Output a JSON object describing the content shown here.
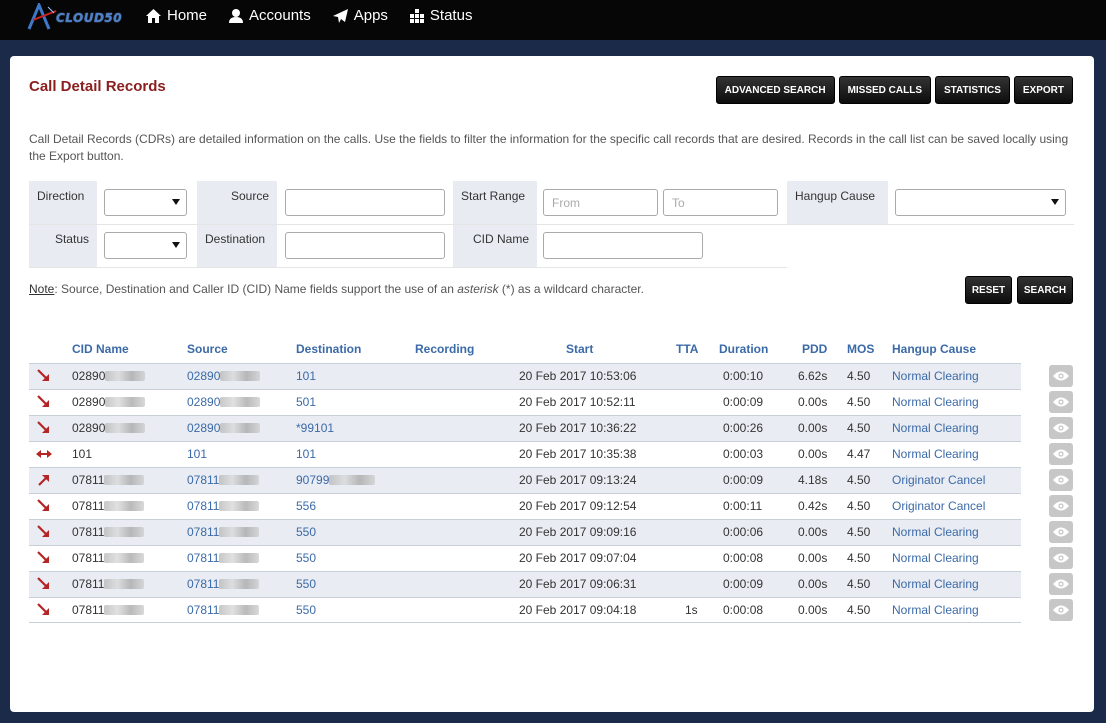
{
  "app": {
    "name": "CLOUD50"
  },
  "nav": [
    {
      "label": "Home",
      "icon": "home-icon"
    },
    {
      "label": "Accounts",
      "icon": "user-icon"
    },
    {
      "label": "Apps",
      "icon": "paper-plane-icon"
    },
    {
      "label": "Status",
      "icon": "grid-icon"
    }
  ],
  "page": {
    "title": "Call Detail Records",
    "description": "Call Detail Records (CDRs) are detailed information on the calls. Use the fields to filter the information for the specific call records that are desired. Records in the call list can be saved locally using the Export button.",
    "buttons": {
      "advanced_search": "ADVANCED SEARCH",
      "missed_calls": "MISSED CALLS",
      "statistics": "STATISTICS",
      "export": "EXPORT"
    }
  },
  "filters": {
    "direction": {
      "label": "Direction",
      "value": ""
    },
    "source": {
      "label": "Source",
      "value": ""
    },
    "start_range": {
      "label": "Start Range",
      "from_placeholder": "From",
      "to_placeholder": "To"
    },
    "hangup_cause": {
      "label": "Hangup Cause",
      "value": ""
    },
    "status": {
      "label": "Status",
      "value": ""
    },
    "destination": {
      "label": "Destination",
      "value": ""
    },
    "cid_name": {
      "label": "CID Name",
      "value": ""
    },
    "note_prefix": "Note",
    "note_text_1": ": Source, Destination and Caller ID (CID) Name fields support the use of an ",
    "note_em": "asterisk",
    "note_text_2": " (*) as a wildcard character.",
    "reset": "RESET",
    "search": "SEARCH"
  },
  "table": {
    "columns": [
      "CID Name",
      "Source",
      "Destination",
      "Recording",
      "Start",
      "TTA",
      "Duration",
      "PDD",
      "MOS",
      "Hangup Cause"
    ],
    "rows": [
      {
        "direction": "inbound",
        "cid": "02890",
        "source": "02890",
        "destination": "101",
        "recording": "",
        "start": "20 Feb 2017 10:53:06",
        "tta": "",
        "duration": "0:00:10",
        "pdd": "6.62s",
        "mos": "4.50",
        "hangup": "Normal Clearing"
      },
      {
        "direction": "inbound",
        "cid": "02890",
        "source": "02890",
        "destination": "501",
        "recording": "",
        "start": "20 Feb 2017 10:52:11",
        "tta": "",
        "duration": "0:00:09",
        "pdd": "0.00s",
        "mos": "4.50",
        "hangup": "Normal Clearing"
      },
      {
        "direction": "inbound",
        "cid": "02890",
        "source": "02890",
        "destination": "*99101",
        "recording": "",
        "start": "20 Feb 2017 10:36:22",
        "tta": "",
        "duration": "0:00:26",
        "pdd": "0.00s",
        "mos": "4.50",
        "hangup": "Normal Clearing"
      },
      {
        "direction": "internal",
        "cid": "101",
        "source": "101",
        "destination": "101",
        "recording": "",
        "start": "20 Feb 2017 10:35:38",
        "tta": "",
        "duration": "0:00:03",
        "pdd": "0.00s",
        "mos": "4.47",
        "hangup": "Normal Clearing"
      },
      {
        "direction": "outbound",
        "cid": "07811",
        "source": "07811",
        "destination": "90799",
        "recording": "",
        "start": "20 Feb 2017 09:13:24",
        "tta": "",
        "duration": "0:00:09",
        "pdd": "4.18s",
        "mos": "4.50",
        "hangup": "Originator Cancel"
      },
      {
        "direction": "inbound",
        "cid": "07811",
        "source": "07811",
        "destination": "556",
        "recording": "",
        "start": "20 Feb 2017 09:12:54",
        "tta": "",
        "duration": "0:00:11",
        "pdd": "0.42s",
        "mos": "4.50",
        "hangup": "Originator Cancel"
      },
      {
        "direction": "inbound",
        "cid": "07811",
        "source": "07811",
        "destination": "550",
        "recording": "",
        "start": "20 Feb 2017 09:09:16",
        "tta": "",
        "duration": "0:00:06",
        "pdd": "0.00s",
        "mos": "4.50",
        "hangup": "Normal Clearing"
      },
      {
        "direction": "inbound",
        "cid": "07811",
        "source": "07811",
        "destination": "550",
        "recording": "",
        "start": "20 Feb 2017 09:07:04",
        "tta": "",
        "duration": "0:00:08",
        "pdd": "0.00s",
        "mos": "4.50",
        "hangup": "Normal Clearing"
      },
      {
        "direction": "inbound",
        "cid": "07811",
        "source": "07811",
        "destination": "550",
        "recording": "",
        "start": "20 Feb 2017 09:06:31",
        "tta": "",
        "duration": "0:00:09",
        "pdd": "0.00s",
        "mos": "4.50",
        "hangup": "Normal Clearing"
      },
      {
        "direction": "inbound",
        "cid": "07811",
        "source": "07811",
        "destination": "550",
        "recording": "",
        "start": "20 Feb 2017 09:04:18",
        "tta": "1s",
        "duration": "0:00:08",
        "pdd": "0.00s",
        "mos": "4.50",
        "hangup": "Normal Clearing"
      }
    ]
  },
  "colors": {
    "accent_red": "#8b1e1e",
    "link_blue": "#3b6aa8",
    "row_alt": "#e9ecf2",
    "nav_bg": "#060606"
  }
}
